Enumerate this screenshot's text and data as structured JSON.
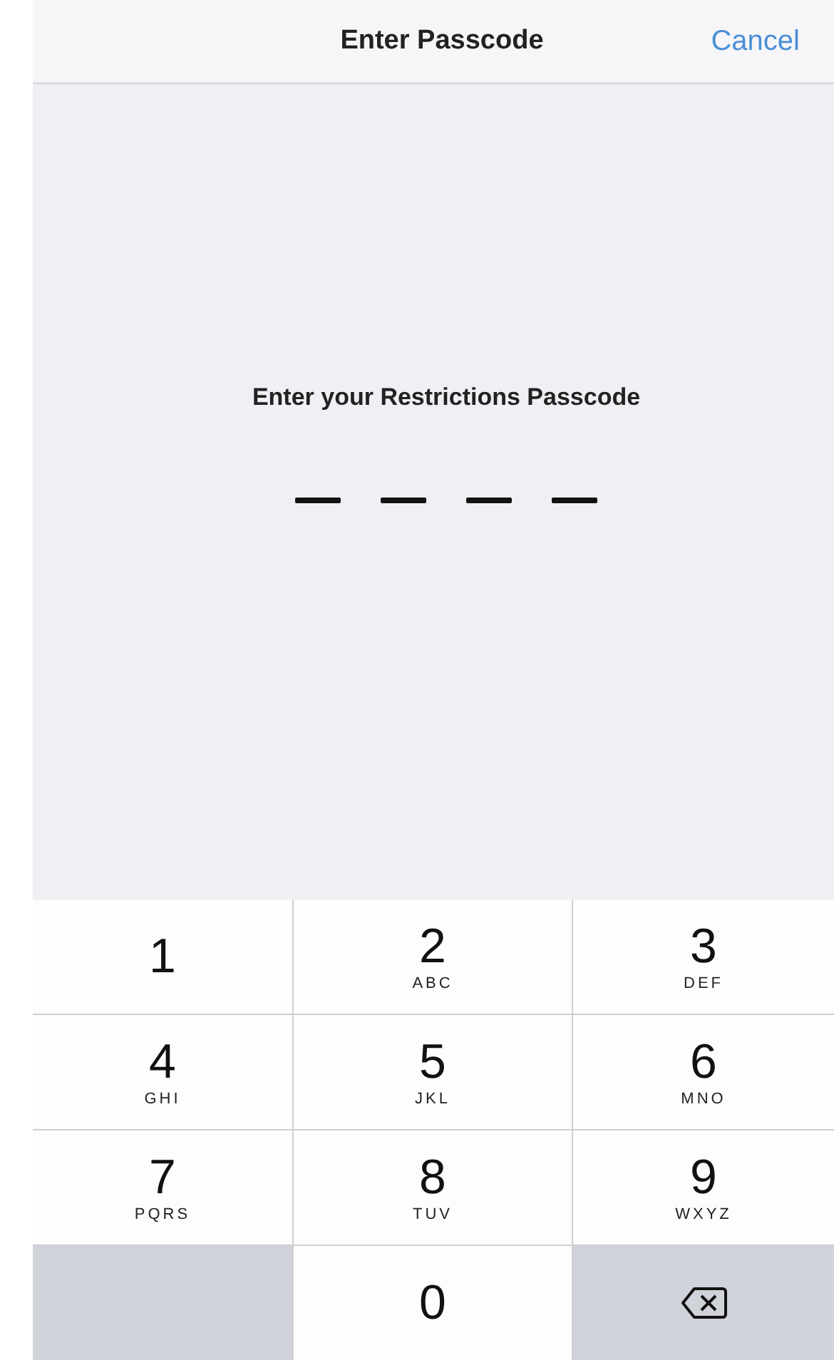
{
  "nav_bar": {
    "title": "Enter Passcode",
    "cancel": "Cancel"
  },
  "prompt": "Enter your Restrictions Passcode",
  "passcode_slots": [
    {
      "filled": false
    },
    {
      "filled": false
    },
    {
      "filled": false
    },
    {
      "filled": false
    }
  ],
  "keypad": [
    {
      "kind": "digit",
      "digit": "1"
    },
    {
      "kind": "digit",
      "digit": "2",
      "letters": "ABC"
    },
    {
      "kind": "digit",
      "digit": "3",
      "letters": "DEF"
    },
    {
      "kind": "digit",
      "digit": "4",
      "letters": "GHI"
    },
    {
      "kind": "digit",
      "digit": "5",
      "letters": "JKL"
    },
    {
      "kind": "digit",
      "digit": "6",
      "letters": "MNO"
    },
    {
      "kind": "digit",
      "digit": "7",
      "letters": "PQRS"
    },
    {
      "kind": "digit",
      "digit": "8",
      "letters": "TUV"
    },
    {
      "kind": "digit",
      "digit": "9",
      "letters": "WXYZ"
    },
    {
      "kind": "blank"
    },
    {
      "kind": "digit",
      "digit": "0"
    },
    {
      "kind": "delete"
    }
  ]
}
